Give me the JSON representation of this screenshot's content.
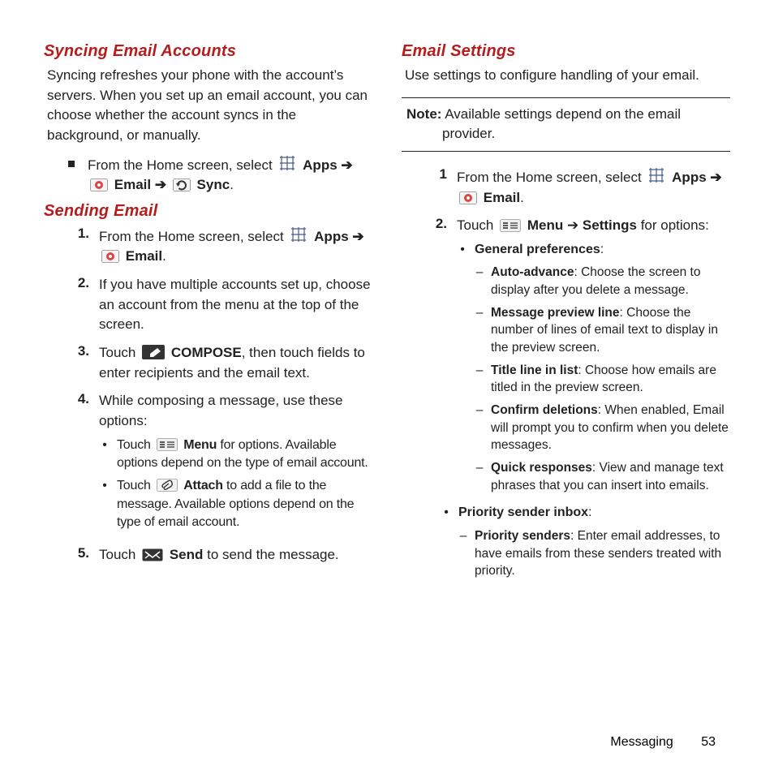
{
  "left": {
    "h_sync": "Syncing Email Accounts",
    "sync_body": "Syncing refreshes your phone with the account’s servers. When you set up an email account, you can choose whether the account syncs in the background, or manually.",
    "sync_step_a": "From the Home screen, select ",
    "apps": "Apps",
    "email": "Email",
    "sync": "Sync",
    "arrow": "➔",
    "h_send": "Sending Email",
    "s1_a": "From the Home screen, select ",
    "s2": "If you have multiple accounts set up, choose an account from the menu at the top of the screen.",
    "s3_a": "Touch ",
    "compose": "COMPOSE",
    "s3_b": ", then touch fields to enter recipients and the email text.",
    "s4": "While composing a message, use these options:",
    "s4b1_a": "Touch ",
    "menu": "Menu",
    "s4b1_b": " for options. Available options depend on the type of email account.",
    "s4b2_a": "Touch ",
    "attach": "Attach",
    "s4b2_b": " to add a file to the message. Available options depend on the type of email account.",
    "s5_a": "Touch ",
    "send": "Send",
    "s5_b": " to send the message."
  },
  "right": {
    "h_settings": "Email Settings",
    "settings_body": "Use settings to configure handling of your email.",
    "note_label": "Note:",
    "note_body": " Available settings depend on the email provider.",
    "s1_a": "From the Home screen, select ",
    "apps": "Apps",
    "email": "Email",
    "arrow": "➔",
    "s2_a": "Touch ",
    "menu": "Menu",
    "s2_b": " ➔ ",
    "settings": "Settings",
    "s2_c": " for options:",
    "b1_label": "General preferences",
    "b1_colon": ":",
    "d1_label": "Auto-advance",
    "d1_body": ": Choose the screen to display after you delete a message.",
    "d2_label": "Message preview line",
    "d2_body": ": Choose the number of lines of email text to display in the preview screen.",
    "d3_label": "Title line in list",
    "d3_body": ": Choose how emails are titled in the preview screen.",
    "d4_label": "Confirm deletions",
    "d4_body": ": When enabled, Email will prompt you to confirm when you delete messages.",
    "d5_label": "Quick responses",
    "d5_body": ": View and manage text phrases that you can insert into emails.",
    "b2_label": "Priority sender inbox",
    "b2_colon": ":",
    "d6_label": "Priority senders",
    "d6_body": ": Enter email addresses, to have emails from these senders treated with priority."
  },
  "footer": {
    "section": "Messaging",
    "page": "53"
  }
}
